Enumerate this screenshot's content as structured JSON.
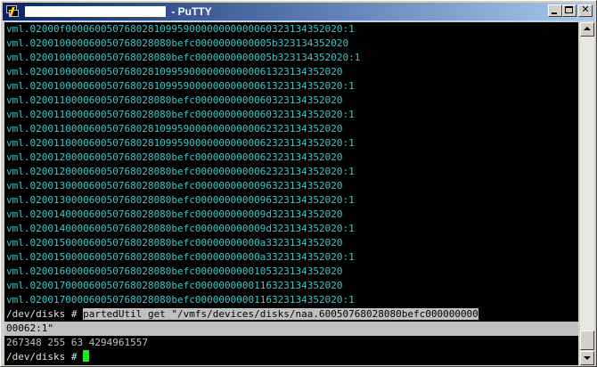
{
  "window": {
    "title": " - PuTTY"
  },
  "terminal": {
    "lines": [
      "vml.02000f00006005076802810995900000000000060323134352020:1",
      "vml.020010000060050768028080befc0000000000005b323134352020",
      "vml.020010000060050768028080befc0000000000005b323134352020:1",
      "vml.02001000006005076802810995900000000000061323134352020",
      "vml.02001000006005076802810995900000000000061323134352020:1",
      "vml.020011000060050768028080befc0000000000060323134352020",
      "vml.020011000060050768028080befc0000000000060323134352020:1",
      "vml.02001100006005076802810995900000000000062323134352020",
      "vml.02001100006005076802810995900000000000062323134352020:1",
      "vml.020012000060050768028080befc0000000000062323134352020",
      "vml.020012000060050768028080befc0000000000062323134352020:1",
      "vml.020013000060050768028080befc0000000000096323134352020",
      "vml.020013000060050768028080befc0000000000096323134352020:1",
      "vml.020014000060050768028080befc000000000009d323134352020",
      "vml.020014000060050768028080befc000000000009d323134352020:1",
      "vml.020015000060050768028080befc00000000000a3323134352020",
      "vml.020015000060050768028080befc00000000000a3323134352020:1",
      "vml.020016000060050768028080befc0000000000105323134352020",
      "vml.020017000060050768028080befc0000000000116323134352020",
      "vml.020017000060050768028080befc0000000000116323134352020:1"
    ],
    "prompt1": "/dev/disks # ",
    "command_part1": "partedUtil get \"/vmfs/devices/disks/naa.60050768028080befc000000000",
    "command_part2": "00062:1\"",
    "output": "267348 255 63 4294961557",
    "prompt2": "/dev/disks # "
  },
  "colors": {
    "terminal_bg": "#000000",
    "listing_text": "#3ec7c7",
    "cursor": "#00ff00",
    "title_gradient_start": "#0a246a",
    "title_gradient_end": "#a6caf0"
  }
}
